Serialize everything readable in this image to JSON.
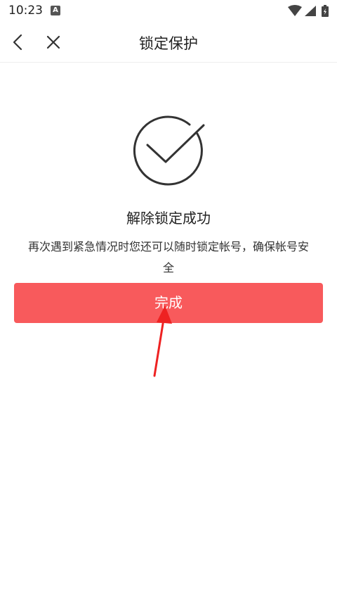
{
  "status_bar": {
    "time": "10:23",
    "notification_icon": "a-icon",
    "wifi_icon": "wifi-icon",
    "signal_icon": "signal-icon",
    "battery_icon": "battery-icon"
  },
  "nav": {
    "back_icon": "chevron-left-icon",
    "close_icon": "close-icon",
    "title": "锁定保护"
  },
  "result": {
    "icon": "check-circle-icon",
    "title": "解除锁定成功",
    "description": "再次遇到紧急情况时您还可以随时锁定帐号，确保帐号安全"
  },
  "actions": {
    "done_label": "完成"
  },
  "colors": {
    "accent": "#f85a5c",
    "arrow": "#ee2222"
  }
}
